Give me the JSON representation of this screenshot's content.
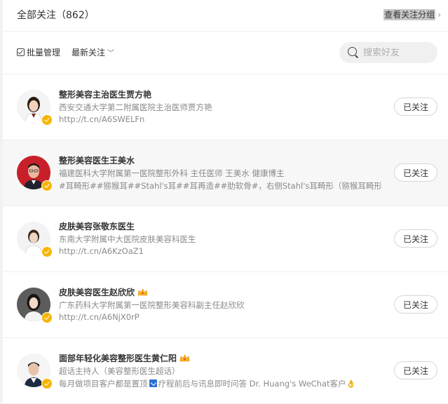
{
  "header": {
    "title": "全部关注（862）",
    "group_link": "查看关注分组"
  },
  "toolbar": {
    "batch_label": "批量管理",
    "sort_label": "最新关注",
    "search_placeholder": "搜索好友"
  },
  "follow_label": "已关注",
  "items": [
    {
      "name": "整形美容主治医生贾方艳",
      "desc": "西安交通大学第二附属医院主治医师贾方艳",
      "url": "http://t.cn/A6SWELFn"
    },
    {
      "name": "整形美容医生王美水",
      "desc": "福建医科大学附属第一医院整形外科 主任医师 王美水 健康博主",
      "url": "#耳畸形##猕猴耳##Stahl's耳##耳再造##肋软骨#，右侧Stahl's耳畸形（猕猴耳畸形…"
    },
    {
      "name": "皮肤美容张敬东医生",
      "desc": "东南大学附属中大医院皮肤美容科医生",
      "url": "http://t.cn/A6KzOaZ1"
    },
    {
      "name": "皮肤美容医生赵欣欣",
      "desc": "广东药科大学附属第一医院整形美容科副主任赵欣欣",
      "url": "http://t.cn/A6NjX0rP"
    },
    {
      "name": "面部年轻化美容整形医生黄仁阳",
      "desc": "超话主持人（美容整形医生超话）",
      "url_before": "每月做项目客户都是置顶",
      "url_after": "疗程前后与讯息即时问答 Dr. Huang's WeChat客户"
    }
  ],
  "colors": {
    "badge": "#f7b500",
    "hover_row": "#f7f7f7",
    "pin": "#2b6fd4"
  }
}
